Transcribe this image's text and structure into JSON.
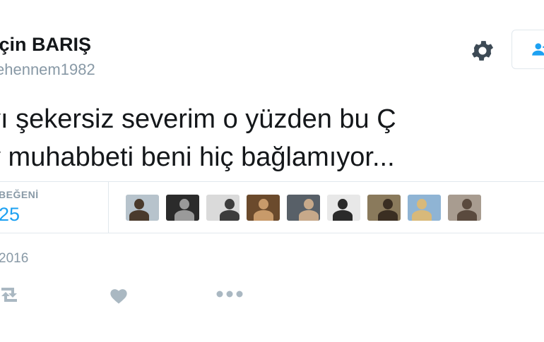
{
  "user": {
    "display_name": "rçin BARIŞ",
    "handle": "ehennem1982"
  },
  "tweet": {
    "line1": "yı şekersiz severim o yüzden bu Ç",
    "line2": "y muhabbeti beni hiç bağlamıyor..."
  },
  "stats": {
    "likes_label": "BEĞENİ",
    "likes_count": "25"
  },
  "liker_avatars": [
    {
      "bg": "#b7c3cc",
      "fg": "#4a3a2c"
    },
    {
      "bg": "#2b2b2b",
      "fg": "#9a9a9a"
    },
    {
      "bg": "#dadada",
      "fg": "#3c3c3c"
    },
    {
      "bg": "#6b4a2c",
      "fg": "#c89a6a"
    },
    {
      "bg": "#586068",
      "fg": "#c7a98a"
    },
    {
      "bg": "#e8e8e8",
      "fg": "#2a2a2a"
    },
    {
      "bg": "#8a7a5c",
      "fg": "#3a2e22"
    },
    {
      "bg": "#8fb4d4",
      "fg": "#d8b97a"
    },
    {
      "bg": "#a89c90",
      "fg": "#5a4a3e"
    }
  ],
  "meta": {
    "date": "2016"
  },
  "icons": {
    "settings": "gear-icon",
    "follow": "user-follow-icon",
    "retweet": "retweet-icon",
    "like": "heart-icon",
    "more": "more-icon"
  },
  "colors": {
    "text": "#14171a",
    "muted": "#8899a6",
    "accent": "#1da1f2",
    "divider": "#e1e8ed"
  }
}
